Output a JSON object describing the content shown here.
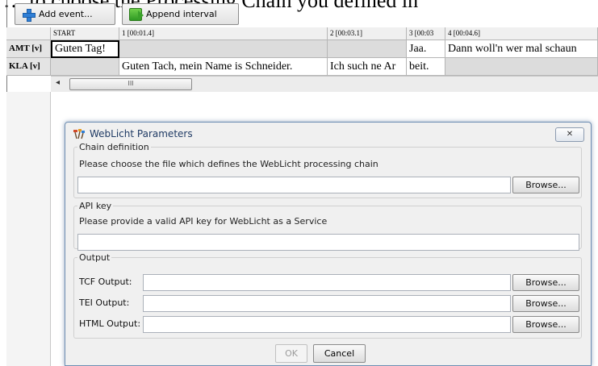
{
  "document": {
    "clipped_text": "… to choose the Processing Chain you defined in"
  },
  "toolbar": {
    "add_event_label": "Add event...",
    "append_interval_label": "Append interval"
  },
  "grid": {
    "headers": [
      "START",
      "1 [00:01.4]",
      "2 [00:03.1]",
      "3 [00:03",
      "4 [00:04.6]"
    ],
    "rows": [
      {
        "label": "AMT [v]",
        "cells": [
          "Guten Tag!",
          "",
          "",
          "Jaa.",
          "Dann woll'n wer mal schaun"
        ]
      },
      {
        "label": "KLA [v]",
        "cells": [
          "",
          "Guten Tach, mein Name is Schneider.",
          "Ich such ne Ar",
          "beit.",
          ""
        ]
      }
    ],
    "scroll_left_glyph": "◂",
    "scroll_thumb_glyph": "III"
  },
  "dialog": {
    "title": "WebLicht Parameters",
    "close_glyph": "✕",
    "chain": {
      "legend": "Chain definition",
      "description": "Please choose the file which defines the WebLicht processing chain",
      "value": "",
      "browse_label": "Browse..."
    },
    "api": {
      "legend": "API key",
      "description": "Please provide a valid API key for WebLicht as a Service",
      "value": ""
    },
    "output": {
      "legend": "Output",
      "tcf_label": "TCF Output:",
      "tei_label": "TEI Output:",
      "html_label": "HTML Output:",
      "tcf_value": "",
      "tei_value": "",
      "html_value": "",
      "browse_label": "Browse..."
    },
    "ok_label": "OK",
    "cancel_label": "Cancel"
  },
  "colors": {
    "accent": "#1f3a64",
    "event_grey": "#dcdcdc"
  }
}
